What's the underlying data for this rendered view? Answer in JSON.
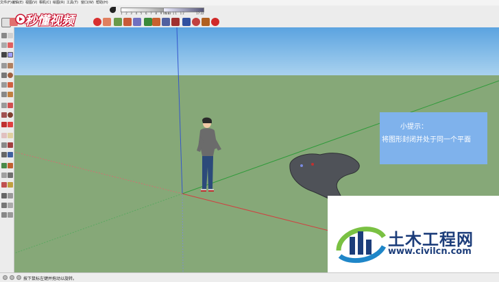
{
  "menubar": {
    "items": [
      "文件(F)",
      "编辑(E)",
      "视图(V)",
      "相机(C)",
      "绘图(R)",
      "工具(T)",
      "窗口(W)",
      "帮助(H)"
    ]
  },
  "toolbar": {
    "shadow_ticks": "1 2 3 4 5 6 7 8 9 10 11 12",
    "time_start": "06:33",
    "time_end": "17:22"
  },
  "brand": {
    "logo_text": "秒懂视频"
  },
  "tip": {
    "title": "小提示：",
    "body": "将图形封闭并处于同一个平面"
  },
  "watermark": {
    "site_name": "土木工程网",
    "url": "www.civilcn.com"
  },
  "status": {
    "text": "按下鼠标左键并拖动以旋转。"
  },
  "colors": {
    "sky": "#74b4e6",
    "ground": "#86a878",
    "tip_bg": "#7fb2ec",
    "shape_fill": "#4f5258",
    "axis_red": "#d04040",
    "axis_green": "#3aa044",
    "axis_blue": "#3355cc"
  }
}
